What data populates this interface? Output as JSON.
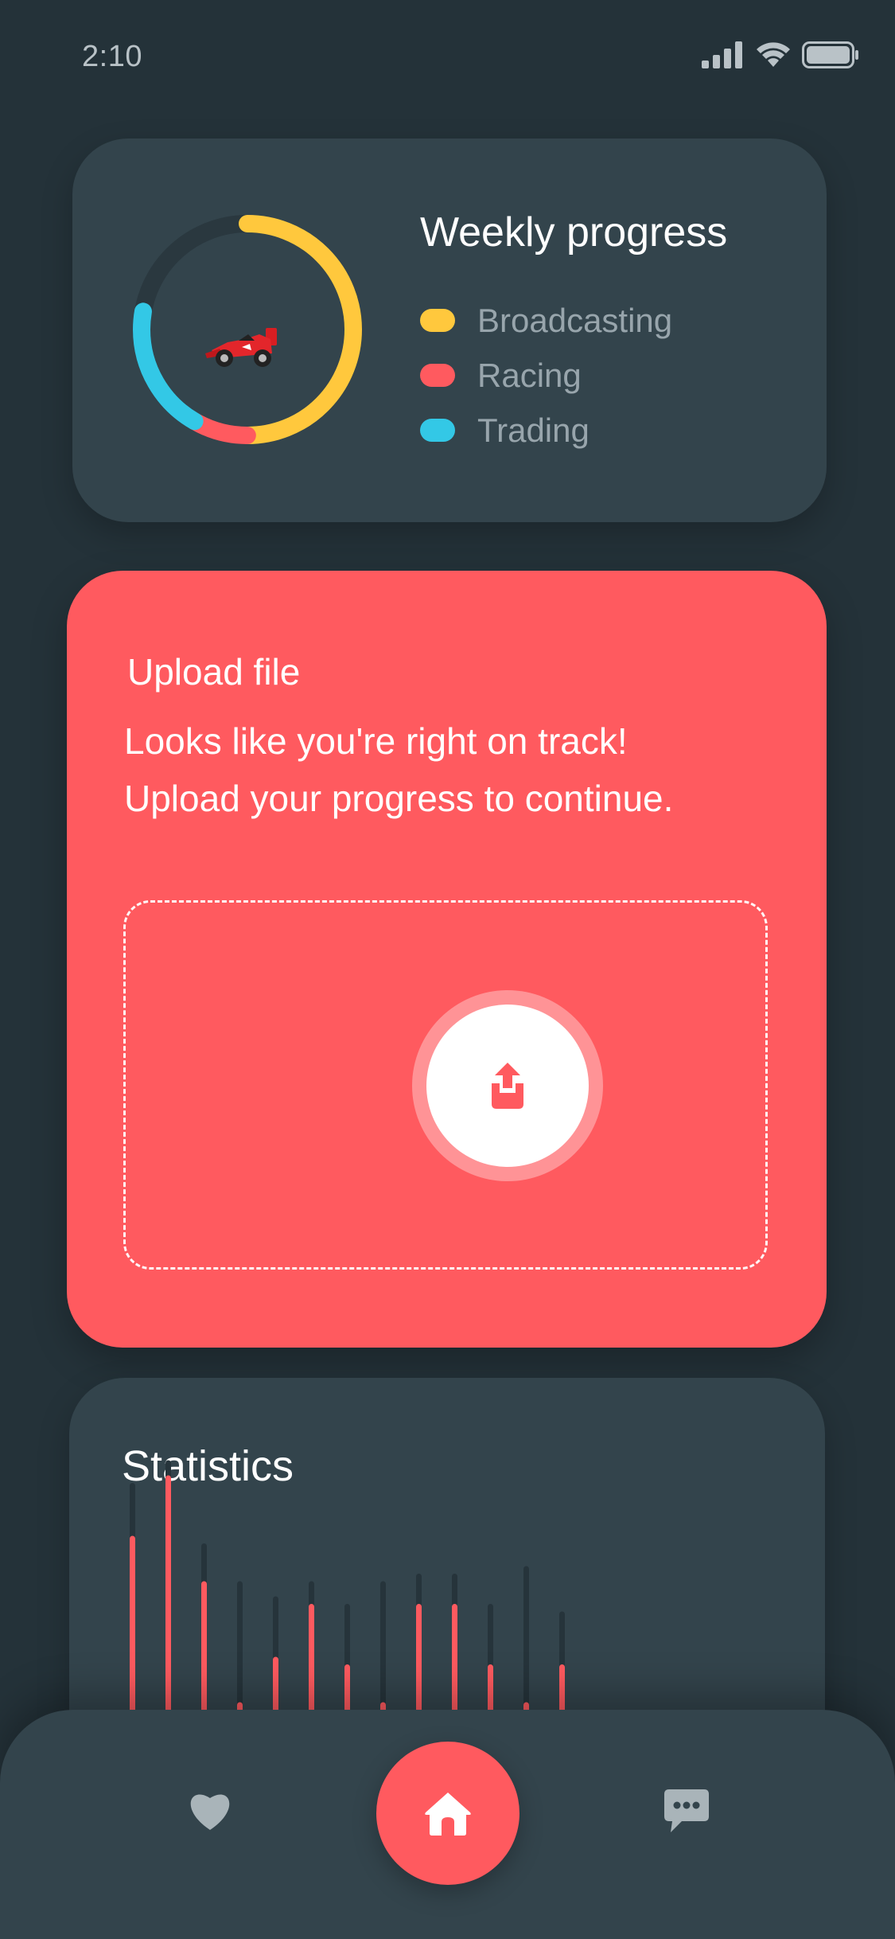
{
  "status_bar": {
    "time": "2:10",
    "icons": [
      "signal-icon",
      "wifi-icon",
      "battery-icon"
    ]
  },
  "progress_card": {
    "title": "Weekly progress",
    "legend": [
      {
        "label": "Broadcasting",
        "color": "#ffc83d"
      },
      {
        "label": "Racing",
        "color": "#ff5a5f"
      },
      {
        "label": "Trading",
        "color": "#33c8e6"
      }
    ],
    "donut_fractions": [
      0.5,
      0.083,
      0.194
    ],
    "track_color": "#2a383f"
  },
  "upload_card": {
    "title": "Upload file",
    "message_line1": "Looks like you're right on track!",
    "message_line2": "Upload your progress to continue.",
    "icon": "upload-icon"
  },
  "stats_card": {
    "title": "Statistics",
    "chart_data": {
      "type": "bar",
      "series": [
        {
          "name": "",
          "values": [
            30,
            33,
            22,
            17,
            15,
            17,
            14,
            17,
            18,
            18,
            14,
            19,
            13
          ]
        },
        {
          "name": "",
          "values": [
            23,
            31,
            17,
            1,
            7,
            14,
            6,
            1,
            14,
            14,
            6,
            1,
            6
          ]
        }
      ],
      "colors": [
        "#26343b",
        "#ff5a5f"
      ]
    }
  },
  "bottom_nav": {
    "items": [
      {
        "name": "favorites",
        "icon": "heart-icon"
      },
      {
        "name": "home",
        "icon": "home-icon",
        "active": true
      },
      {
        "name": "messages",
        "icon": "chat-icon"
      }
    ],
    "accent": "#ff5a5f"
  }
}
